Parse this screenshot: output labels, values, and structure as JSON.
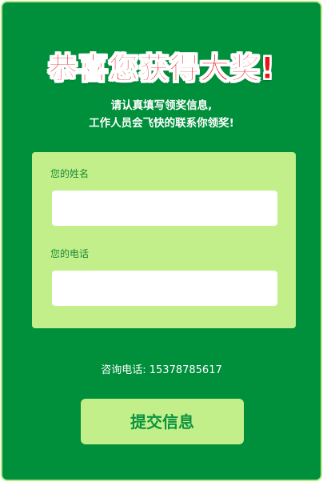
{
  "headline": "恭喜您获得大奖!",
  "subtitle": {
    "line1": "请认真填写领奖信息,",
    "line2": "工作人员会飞快的联系你领奖!"
  },
  "form": {
    "name_label": "您的姓名",
    "name_value": "",
    "phone_label": "您的电话",
    "phone_value": ""
  },
  "hotline": {
    "label": "咨询电话:",
    "number": "15378785617"
  },
  "submit_label": "提交信息",
  "colors": {
    "background": "#008f3b",
    "border": "#b7ea86",
    "card": "#c3ef8b",
    "headline": "#e8141b",
    "label_text": "#1a8a35"
  }
}
